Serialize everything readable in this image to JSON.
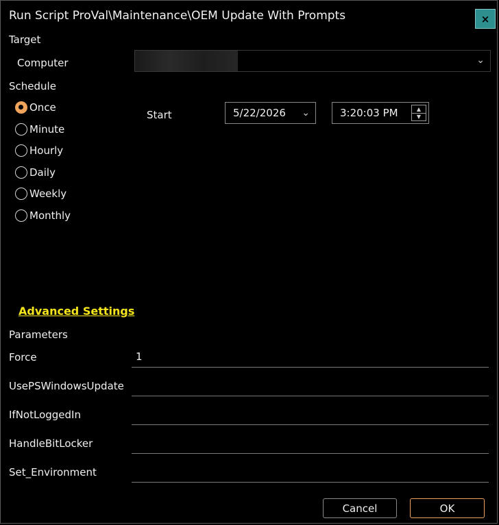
{
  "window": {
    "title": "Run Script ProVal\\Maintenance\\OEM Update With Prompts",
    "close_label": "×"
  },
  "target": {
    "section_label": "Target",
    "computer_label": "Computer",
    "computer_value": ""
  },
  "schedule": {
    "section_label": "Schedule",
    "options": [
      {
        "label": "Once",
        "checked": true
      },
      {
        "label": "Minute",
        "checked": false
      },
      {
        "label": "Hourly",
        "checked": false
      },
      {
        "label": "Daily",
        "checked": false
      },
      {
        "label": "Weekly",
        "checked": false
      },
      {
        "label": "Monthly",
        "checked": false
      }
    ],
    "start_label": "Start",
    "start_date": "5/22/2026",
    "start_time": "3:20:03 PM"
  },
  "advanced": {
    "link_label": "Advanced Settings",
    "parameters_label": "Parameters",
    "params": [
      {
        "label": "Force",
        "value": "1"
      },
      {
        "label": "UsePSWindowsUpdate",
        "value": ""
      },
      {
        "label": "IfNotLoggedIn",
        "value": ""
      },
      {
        "label": "HandleBitLocker",
        "value": ""
      },
      {
        "label": "Set_Environment",
        "value": ""
      }
    ]
  },
  "footer": {
    "cancel_label": "Cancel",
    "ok_label": "OK"
  },
  "colors": {
    "accent": "#f0a35a",
    "link": "#f3e41c",
    "close_bg": "#2e8f8f"
  }
}
